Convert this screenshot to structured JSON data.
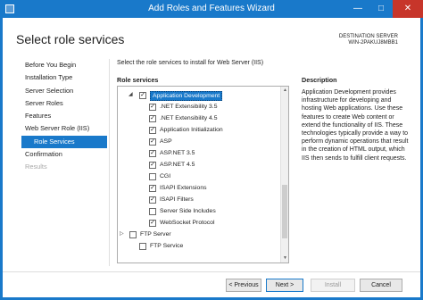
{
  "window": {
    "title": "Add Roles and Features Wizard",
    "minimize_glyph": "—",
    "maximize_glyph": "□",
    "close_glyph": "✕"
  },
  "page": {
    "title": "Select role services",
    "destination_label": "DESTINATION SERVER",
    "destination_server": "WIN-2PAKUJ8MBB1",
    "instruction": "Select the role services to install for Web Server (IIS)"
  },
  "nav": {
    "items": [
      {
        "label": "Before You Begin"
      },
      {
        "label": "Installation Type"
      },
      {
        "label": "Server Selection"
      },
      {
        "label": "Server Roles"
      },
      {
        "label": "Features"
      },
      {
        "label": "Web Server Role (IIS)"
      },
      {
        "label": "Role Services"
      },
      {
        "label": "Confirmation"
      },
      {
        "label": "Results"
      }
    ]
  },
  "role_services": {
    "header": "Role services",
    "rows": [
      {
        "label": "Application Development",
        "checked": true
      },
      {
        "label": ".NET Extensibility 3.5",
        "checked": true
      },
      {
        "label": ".NET Extensibility 4.5",
        "checked": true
      },
      {
        "label": "Application Initialization",
        "checked": true
      },
      {
        "label": "ASP",
        "checked": true
      },
      {
        "label": "ASP.NET 3.5",
        "checked": true
      },
      {
        "label": "ASP.NET 4.5",
        "checked": true
      },
      {
        "label": "CGI",
        "checked": false
      },
      {
        "label": "ISAPI Extensions",
        "checked": true
      },
      {
        "label": "ISAPI Filters",
        "checked": true
      },
      {
        "label": "Server Side Includes",
        "checked": false
      },
      {
        "label": "WebSocket Protocol",
        "checked": true
      },
      {
        "label": "FTP Server",
        "checked": false
      },
      {
        "label": "FTP Service",
        "checked": false
      }
    ]
  },
  "description": {
    "header": "Description",
    "text": "Application Development provides infrastructure for developing and hosting Web applications. Use these features to create Web content or extend the functionality of IIS. These technologies typically provide a way to perform dynamic operations that result in the creation of HTML output, which IIS then sends to fulfill client requests."
  },
  "buttons": {
    "previous": "< Previous",
    "next": "Next >",
    "install": "Install",
    "cancel": "Cancel"
  },
  "colors": {
    "accent": "#1979ca",
    "close": "#c7352a"
  },
  "icons": {
    "check": "✓",
    "expanded": "◢",
    "collapsed": "▷",
    "scroll_up": "▲",
    "scroll_down": "▼"
  }
}
